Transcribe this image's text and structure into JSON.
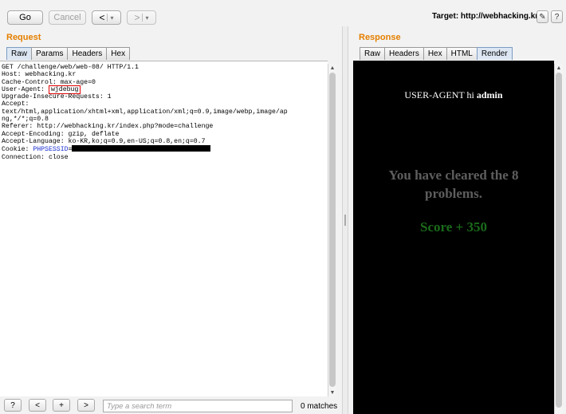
{
  "toolbar": {
    "go_label": "Go",
    "cancel_label": "Cancel",
    "back_label": "<",
    "forward_label": ">",
    "dropdown_glyph": "▾",
    "target_label": "Target: http://webhacking.kr",
    "edit_icon_glyph": "✎",
    "help_icon_glyph": "?"
  },
  "request": {
    "title": "Request",
    "tabs": [
      "Raw",
      "Params",
      "Headers",
      "Hex"
    ],
    "active_tab": "Raw",
    "lines": [
      "GET /challenge/web/web-08/ HTTP/1.1",
      "Host: webhacking.kr",
      "Cache-Control: max-age=0",
      "Upgrade-Insecure-Requests: 1",
      "Accept:",
      "text/html,application/xhtml+xml,application/xml;q=0.9,image/webp,image/ap",
      "ng,*/*;q=0.8",
      "Referer: http://webhacking.kr/index.php?mode=challenge",
      "Accept-Encoding: gzip, deflate",
      "Accept-Language: ko-KR,ko;q=0.9,en-US;q=0.8,en;q=0.7",
      "Connection: close"
    ],
    "user_agent_key": "User-Agent: ",
    "user_agent_value": "wjdebug",
    "cookie_key": "Cookie: ",
    "cookie_name": "PHPSESSID",
    "cookie_eq": "="
  },
  "search": {
    "help_label": "?",
    "prev_label": "<",
    "add_label": "+",
    "next_label": ">",
    "placeholder": "Type a search term",
    "matches": "0 matches"
  },
  "response": {
    "title": "Response",
    "tabs": [
      "Raw",
      "Headers",
      "Hex",
      "HTML",
      "Render"
    ],
    "active_tab": "Render",
    "render": {
      "ua_prefix": "USER-AGENT hi ",
      "ua_user": "admin",
      "cleared_text": "You have cleared the 8 problems.",
      "score_text": "Score + 350"
    }
  },
  "colors": {
    "section_title": "#e57f00",
    "highlight_box": "#e00000",
    "cookie_name": "#1a2ed0",
    "score": "#1a6b1a",
    "cleared": "#5e5e5e"
  }
}
